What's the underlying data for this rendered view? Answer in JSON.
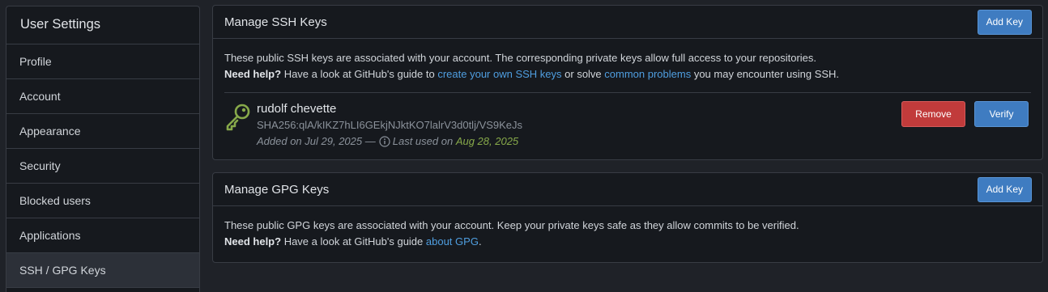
{
  "sidebar": {
    "title": "User Settings",
    "items": [
      {
        "label": "Profile"
      },
      {
        "label": "Account"
      },
      {
        "label": "Appearance"
      },
      {
        "label": "Security"
      },
      {
        "label": "Blocked users"
      },
      {
        "label": "Applications"
      },
      {
        "label": "SSH / GPG Keys"
      }
    ]
  },
  "ssh": {
    "title": "Manage SSH Keys",
    "add_label": "Add Key",
    "desc": "These public SSH keys are associated with your account. The corresponding private keys allow full access to your repositories.",
    "help_bold": "Need help?",
    "help_pre": " Have a look at GitHub's guide to ",
    "help_link1": "create your own SSH keys",
    "help_mid": " or solve ",
    "help_link2": "common problems",
    "help_post": " you may encounter using SSH.",
    "key": {
      "name": "rudolf chevette",
      "fingerprint": "SHA256:qlA/kIKZ7hLI6GEkjNJktKO7lalrV3d0tlj/VS9KeJs",
      "added": "Added on Jul 29, 2025 —",
      "last_used_label": "Last used on",
      "last_used_date": "Aug 28, 2025",
      "remove_label": "Remove",
      "verify_label": "Verify"
    }
  },
  "gpg": {
    "title": "Manage GPG Keys",
    "add_label": "Add Key",
    "desc": "These public GPG keys are associated with your account. Keep your private keys safe as they allow commits to be verified.",
    "help_bold": "Need help?",
    "help_pre": " Have a look at GitHub's guide ",
    "help_link": "about GPG",
    "help_post": "."
  },
  "colors": {
    "accent": "#3f7cc1",
    "danger": "#c13b3b",
    "link": "#4f9ee0",
    "key_icon": "#87a94a"
  },
  "icons": {
    "key": "key-icon",
    "info": "info-icon"
  }
}
